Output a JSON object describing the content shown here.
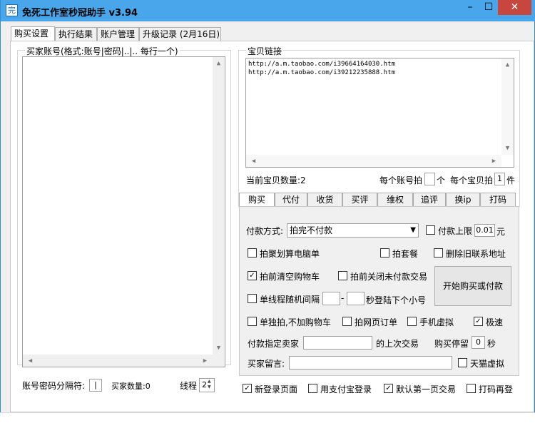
{
  "window": {
    "title": "免死工作室秒冠助手 v3.94",
    "icon_char": "完",
    "controls": {
      "minimize": "–",
      "maximize": "☐",
      "close": "✕"
    }
  },
  "main_tabs": [
    "购买设置",
    "执行结果",
    "账户管理",
    "升级记录 (2月16日)"
  ],
  "buyer_accounts": {
    "legend": "买家账号(格式:账号|密码|..|.. 每行一个)",
    "separator_label": "账号密码分隔符:",
    "separator_value": "|",
    "count_label": "买家数量:0",
    "threads_label": "线程",
    "threads_value": "2"
  },
  "item_links": {
    "legend": "宝贝链接",
    "links": [
      "http://a.m.taobao.com/i39664164030.htm",
      "http://a.m.taobao.com/i39212235888.htm"
    ],
    "current_count_label": "当前宝贝数量:2",
    "per_account_label": "每个账号拍",
    "per_account_value": "",
    "per_account_unit": "个",
    "per_item_label": "每个宝贝拍",
    "per_item_value": "1",
    "per_item_unit": "件"
  },
  "sub_tabs": [
    "购买",
    "代付",
    "收货",
    "买评",
    "维权",
    "追评",
    "换ip",
    "打码"
  ],
  "purchase": {
    "payment_label": "付款方式:",
    "payment_value": "拍完不付款",
    "limit_label": "付款上限",
    "limit_value": "0.01",
    "limit_unit": "元",
    "cb_juhuasuan": "拍聚划算电脑单",
    "cb_package": "拍套餐",
    "cb_delete_addr": "删除旧联系地址",
    "cb_clear_cart": "拍前清空购物车",
    "cb_close_unpaid": "拍前关闭未付款交易",
    "start_button": "开始购买或付款",
    "cb_random_interval": "单线程随机间隔",
    "interval_dash": "-",
    "interval_suffix": "秒登陆下个小号",
    "cb_single": "单独拍,不加购物车",
    "cb_web_order": "拍网页订单",
    "cb_mobile": "手机虚拟",
    "cb_fast": "极速",
    "seller_label": "付款指定卖家",
    "seller_suffix": "的上次交易",
    "stay_label": "购买停留",
    "stay_value": "0",
    "stay_unit": "秒",
    "message_label": "买家留言:",
    "cb_tmall": "天猫虚拟"
  },
  "bottom_options": {
    "cb_new_login": "新登录页面",
    "cb_alipay": "用支付宝登录",
    "cb_first_page": "默认第一页交易",
    "cb_retry_captcha": "打码再登"
  },
  "checked": {
    "clear_cart": true,
    "fast": true,
    "new_login": true,
    "first_page": true
  },
  "colors": {
    "titlebar": "#4aa6ea",
    "close_button": "#c7463d",
    "border": "#2b8fd8"
  }
}
